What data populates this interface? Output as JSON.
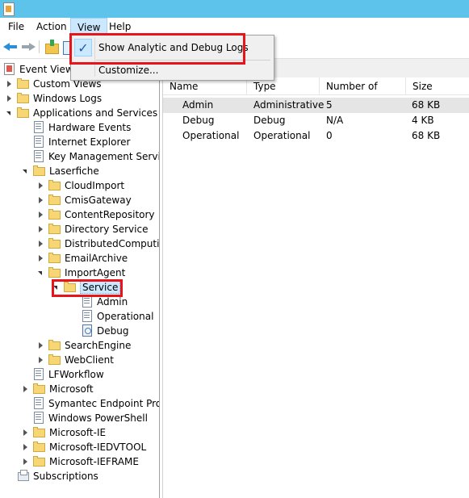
{
  "menu": {
    "file": "File",
    "action": "Action",
    "view": "View",
    "help": "Help"
  },
  "view_menu": {
    "check_mark": "✓",
    "show_analytic": "Show Analytic and Debug Logs",
    "customize": "Customize..."
  },
  "tree": {
    "root": "Event Viewer",
    "custom_views": "Custom Views",
    "windows_logs": "Windows Logs",
    "apps_services": "Applications and Services Lo",
    "hardware_events": "Hardware Events",
    "internet_explorer": "Internet Explorer",
    "key_mgmt": "Key Management Service",
    "laserfiche": "Laserfiche",
    "cloud_import": "CloudImport",
    "cmis_gateway": "CmisGateway",
    "content_repository": "ContentRepository",
    "directory_service": "Directory Service",
    "distributed_computing": "DistributedComputin",
    "email_archive": "EmailArchive",
    "import_agent": "ImportAgent",
    "service": "Service",
    "admin": "Admin",
    "operational": "Operational",
    "debug": "Debug",
    "search_engine": "SearchEngine",
    "web_client": "WebClient",
    "lf_workflow": "LFWorkflow",
    "microsoft": "Microsoft",
    "symantec": "Symantec Endpoint Prote",
    "powershell": "Windows PowerShell",
    "ms_ie": "Microsoft-IE",
    "ms_iedvtool": "Microsoft-IEDVTOOL",
    "ms_ieframe": "Microsoft-IEFRAME",
    "subscriptions": "Subscriptions"
  },
  "table": {
    "headers": [
      "Name",
      "Type",
      "Number of Events",
      "Size"
    ],
    "rows": [
      [
        "Admin",
        "Administrative",
        "5",
        "68 KB"
      ],
      [
        "Debug",
        "Debug",
        "N/A",
        "4 KB"
      ],
      [
        "Operational",
        "Operational",
        "0",
        "68 KB"
      ]
    ]
  },
  "colors": {
    "titlebar": "#5ec3ea",
    "highlight_box": "#e8141b",
    "selection": "#cce8ff"
  }
}
